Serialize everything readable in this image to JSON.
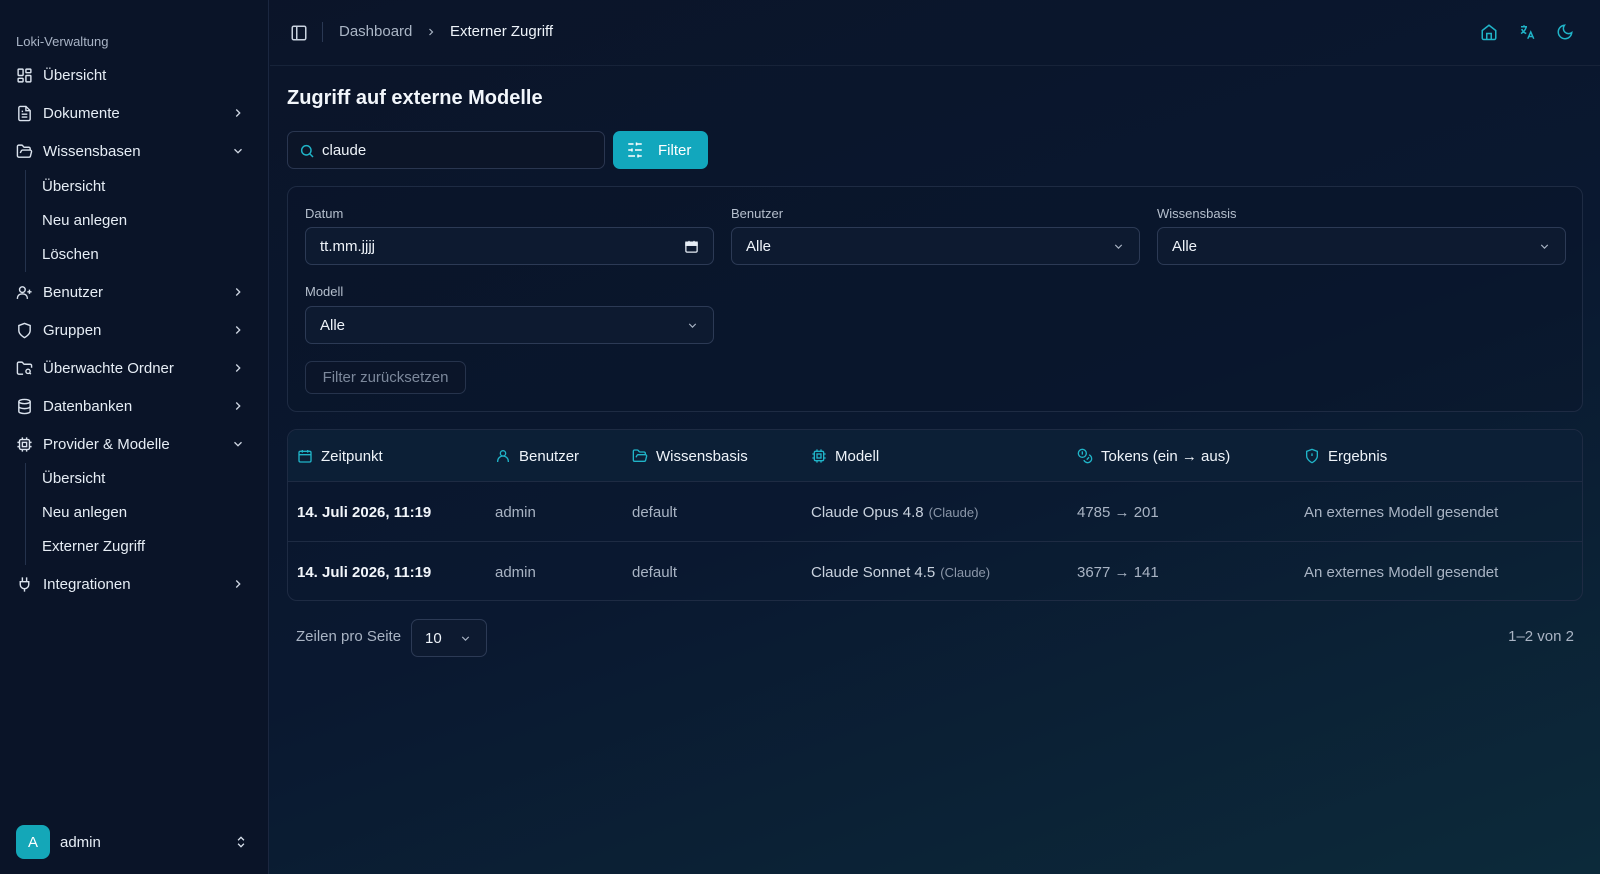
{
  "sidebar": {
    "group_label": "Loki-Verwaltung",
    "items": [
      {
        "label": "Übersicht",
        "icon": "dashboard-grid-icon"
      },
      {
        "label": "Dokumente",
        "icon": "document-icon"
      },
      {
        "label": "Wissensbasen",
        "icon": "folder-open-icon",
        "expanded": true,
        "children": [
          "Übersicht",
          "Neu anlegen",
          "Löschen"
        ]
      },
      {
        "label": "Benutzer",
        "icon": "user-plus-icon"
      },
      {
        "label": "Gruppen",
        "icon": "shield-icon"
      },
      {
        "label": "Überwachte Ordner",
        "icon": "folder-search-icon"
      },
      {
        "label": "Datenbanken",
        "icon": "database-icon"
      },
      {
        "label": "Provider & Modelle",
        "icon": "cpu-icon",
        "expanded": true,
        "children": [
          "Übersicht",
          "Neu anlegen",
          "Externer Zugriff"
        ]
      },
      {
        "label": "Integrationen",
        "icon": "plug-icon"
      }
    ],
    "user": {
      "initial": "A",
      "name": "admin"
    }
  },
  "topbar": {
    "breadcrumb": [
      "Dashboard",
      "Externer Zugriff"
    ],
    "icons": [
      "home-icon",
      "translate-icon",
      "moon-icon"
    ]
  },
  "page": {
    "title": "Zugriff auf externe Modelle",
    "search": {
      "value": "claude"
    },
    "filter_button": "Filter"
  },
  "filters": {
    "datum": {
      "label": "Datum",
      "placeholder": "tt.mm.jjjj"
    },
    "benutzer": {
      "label": "Benutzer",
      "value": "Alle"
    },
    "wissensbasis": {
      "label": "Wissensbasis",
      "value": "Alle"
    },
    "modell": {
      "label": "Modell",
      "value": "Alle"
    },
    "reset": "Filter zurücksetzen"
  },
  "table": {
    "columns": [
      "Zeitpunkt",
      "Benutzer",
      "Wissensbasis",
      "Modell",
      "Tokens (ein → aus)",
      "Ergebnis"
    ],
    "rows": [
      {
        "zeitpunkt": "14. Juli 2026, 11:19",
        "benutzer": "admin",
        "wissensbasis": "default",
        "modell": "Claude Opus 4.8",
        "provider": "(Claude)",
        "tokens": "4785 → 201",
        "ergebnis": "An externes Modell gesendet"
      },
      {
        "zeitpunkt": "14. Juli 2026, 11:19",
        "benutzer": "admin",
        "wissensbasis": "default",
        "modell": "Claude Sonnet 4.5",
        "provider": "(Claude)",
        "tokens": "3677 → 141",
        "ergebnis": "An externes Modell gesendet"
      }
    ]
  },
  "pagination": {
    "rows_label": "Zeilen pro Seite",
    "rows_value": "10",
    "range": "1–2 von 2"
  },
  "colors": {
    "accent": "#12a7bd",
    "background": "#0a1428"
  }
}
